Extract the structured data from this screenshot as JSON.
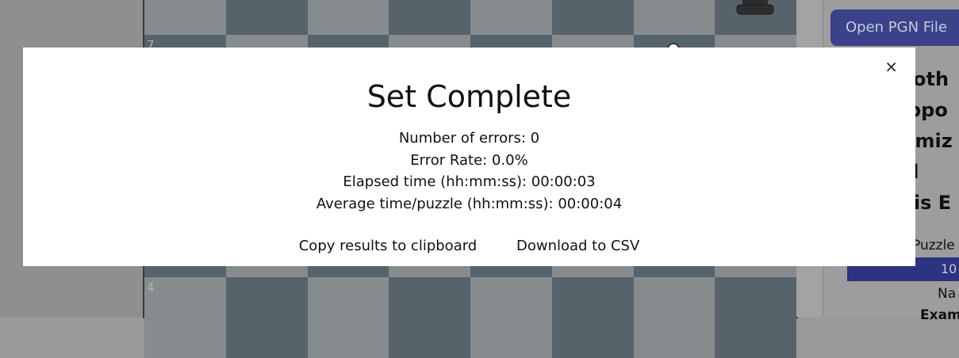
{
  "modal": {
    "title": "Set Complete",
    "close_label": "×",
    "stats": [
      "Number of errors: 0",
      "Error Rate: 0.0%",
      "Elapsed time (hh:mm:ss): 00:00:03",
      "Average time/puzzle (hh:mm:ss): 00:00:04"
    ],
    "copy_label": "Copy results to clipboard",
    "download_label": "Download to CSV"
  },
  "board": {
    "rank_labels": [
      "7",
      "4"
    ],
    "light_color": "#868b8e",
    "dark_color": "#57636b"
  },
  "right_panel": {
    "open_pgn_label": "Open PGN File",
    "fragments": [
      "oth",
      "ppo",
      "omiz",
      "ed",
      "ysis E"
    ],
    "puzzle_label": "Puzzle",
    "puzzle_value": "10",
    "na_label": "Na",
    "exam_label": "Exam"
  }
}
